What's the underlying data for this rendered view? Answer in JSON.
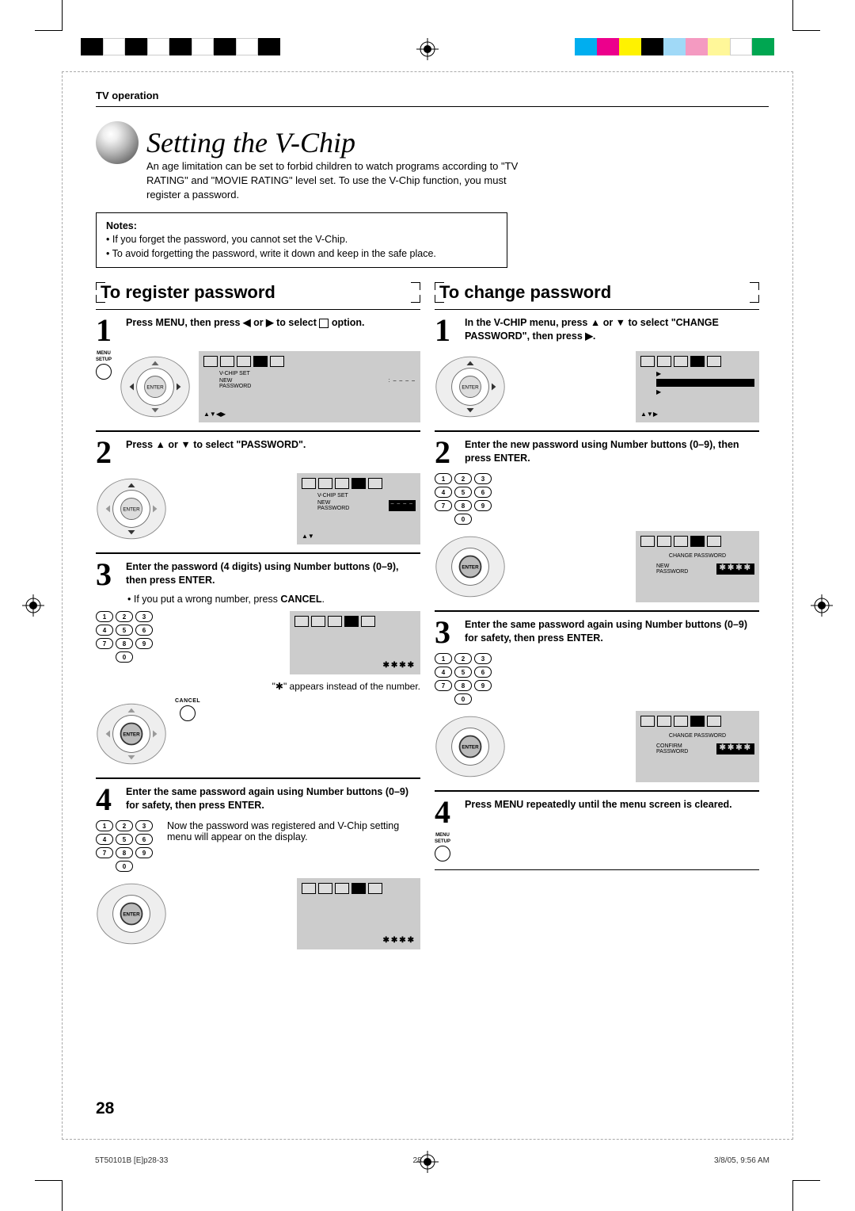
{
  "header": {
    "tv_operation": "TV operation"
  },
  "title": "Setting the V-Chip",
  "intro": "An age limitation can be set to forbid children to watch programs according to \"TV RATING\" and \"MOVIE RATING\" level set. To use the V-Chip function, you must register a password.",
  "notes": {
    "heading": "Notes:",
    "items": [
      "If you forget the password, you cannot set the V-Chip.",
      "To avoid forgetting the password, write it down and keep in the safe place."
    ]
  },
  "left": {
    "heading": "To register password",
    "step1": {
      "text_a": "Press MENU, then press ",
      "text_b": " or ",
      "text_c": " to select ",
      "text_d": " option.",
      "menu_label": "MENU",
      "setup_label": "SETUP",
      "osd_line1": "V-CHIP SET",
      "osd_line2a": "NEW",
      "osd_line2b": "PASSWORD",
      "osd_dots": ": – – – –",
      "osd_arrows": "▲▼◀▶"
    },
    "step2": {
      "text_a": "Press ",
      "text_b": " or ",
      "text_c": " to select \"PASSWORD\".",
      "osd_line1": "V-CHIP SET",
      "osd_line2a": "NEW",
      "osd_line2b": "PASSWORD",
      "osd_dots": "– – – –",
      "osd_arrows": "▲▼"
    },
    "step3": {
      "text": "Enter the password (4 digits) using Number buttons (0–9), then press ENTER.",
      "note_a": "• If you put a wrong number, press ",
      "note_b": "CANCEL",
      "note_c": ".",
      "star_note": "\"✱\" appears instead of the number.",
      "cancel_label": "CANCEL",
      "pw": "✱✱✱✱"
    },
    "step4": {
      "text": "Enter the same password again using Number buttons (0–9) for safety, then press ENTER.",
      "note": "Now the password was registered and V-Chip setting menu will appear on the display.",
      "pw": "✱✱✱✱"
    }
  },
  "right": {
    "heading": "To change password",
    "step1": {
      "text_a": "In the V-CHIP menu, press ",
      "text_b": " or ",
      "text_c": " to select \"CHANGE PASSWORD\", then press ",
      "text_d": ".",
      "osd_arrows": "▲▼▶"
    },
    "step2": {
      "text": "Enter the new password using Number buttons (0–9), then press ENTER.",
      "osd_line1": "CHANGE PASSWORD",
      "osd_line2a": "NEW",
      "osd_line2b": "PASSWORD",
      "pw": "✱✱✱✱"
    },
    "step3": {
      "text": "Enter the same password again using Number buttons (0–9) for safety, then press ENTER.",
      "osd_line1": "CHANGE PASSWORD",
      "osd_line2a": "CONFIRM",
      "osd_line2b": "PASSWORD",
      "pw": "✱✱✱✱"
    },
    "step4": {
      "text": "Press MENU repeatedly until the menu screen is cleared.",
      "menu_label": "MENU",
      "setup_label": "SETUP"
    }
  },
  "keypad": [
    "1",
    "2",
    "3",
    "4",
    "5",
    "6",
    "7",
    "8",
    "9",
    "0"
  ],
  "enter_label": "ENTER",
  "page_number": "28",
  "footer": {
    "left": "5T50101B [E]p28-33",
    "center": "28",
    "right": "3/8/05, 9:56 AM"
  },
  "colorbar_left": [
    "#000",
    "#fff",
    "#000",
    "#fff",
    "#000",
    "#fff",
    "#000",
    "#fff",
    "#000"
  ],
  "colorbar_right": [
    "#00aeef",
    "#ec008c",
    "#fff200",
    "#000",
    "#a0d9f7",
    "#f49ac1",
    "#fff799",
    "#fff",
    "#00a651"
  ]
}
